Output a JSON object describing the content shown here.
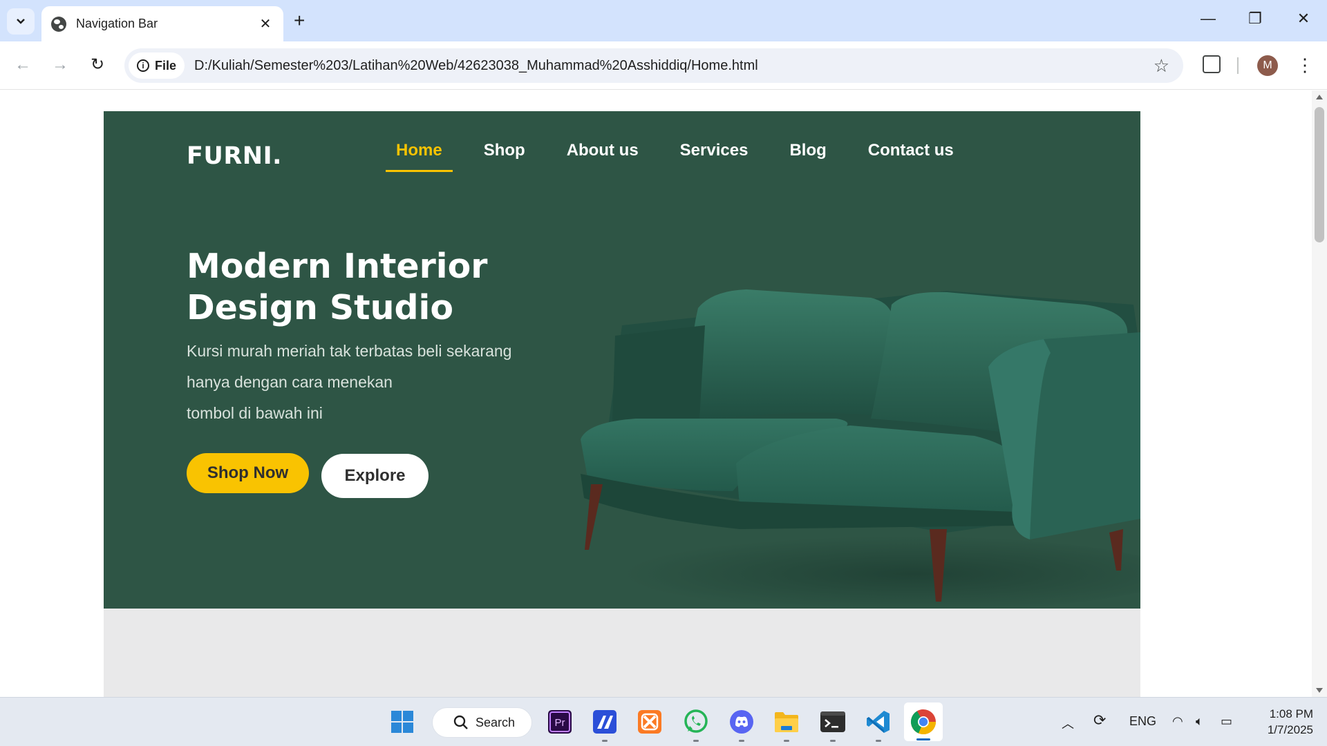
{
  "browser": {
    "tab": {
      "title": "Navigation Bar"
    },
    "new_tab_symbol": "+",
    "controls": {
      "minimize": "—",
      "restore": "❐",
      "close": "✕"
    },
    "site_chip": "File",
    "url": "D:/Kuliah/Semester%203/Latihan%20Web/42623038_Muhammad%20Asshiddiq/Home.html",
    "profile_initial": "M"
  },
  "page": {
    "logo": "FURNI.",
    "nav": [
      {
        "label": "Home",
        "active": true
      },
      {
        "label": "Shop",
        "active": false
      },
      {
        "label": "About us",
        "active": false
      },
      {
        "label": "Services",
        "active": false
      },
      {
        "label": "Blog",
        "active": false
      },
      {
        "label": "Contact us",
        "active": false
      }
    ],
    "hero": {
      "title_line1": "Modern Interior",
      "title_line2": "Design Studio",
      "desc_line1": "Kursi murah meriah tak terbatas beli sekarang",
      "desc_line2": "hanya dengan cara menekan",
      "desc_line3": "tombol di bawah ini",
      "primary_button": "Shop Now",
      "secondary_button": "Explore"
    },
    "colors": {
      "hero_bg": "#2e5545",
      "accent": "#f9c301",
      "sofa": "#2f6b5a"
    }
  },
  "taskbar": {
    "search_label": "Search",
    "apps": [
      "start-icon",
      "premiere-icon",
      "app-icon",
      "xampp-icon",
      "whatsapp-icon",
      "discord-icon",
      "file-explorer-icon",
      "terminal-icon",
      "vscode-icon",
      "chrome-icon"
    ],
    "language": "ENG",
    "time": "1:08 PM",
    "date": "1/7/2025"
  }
}
